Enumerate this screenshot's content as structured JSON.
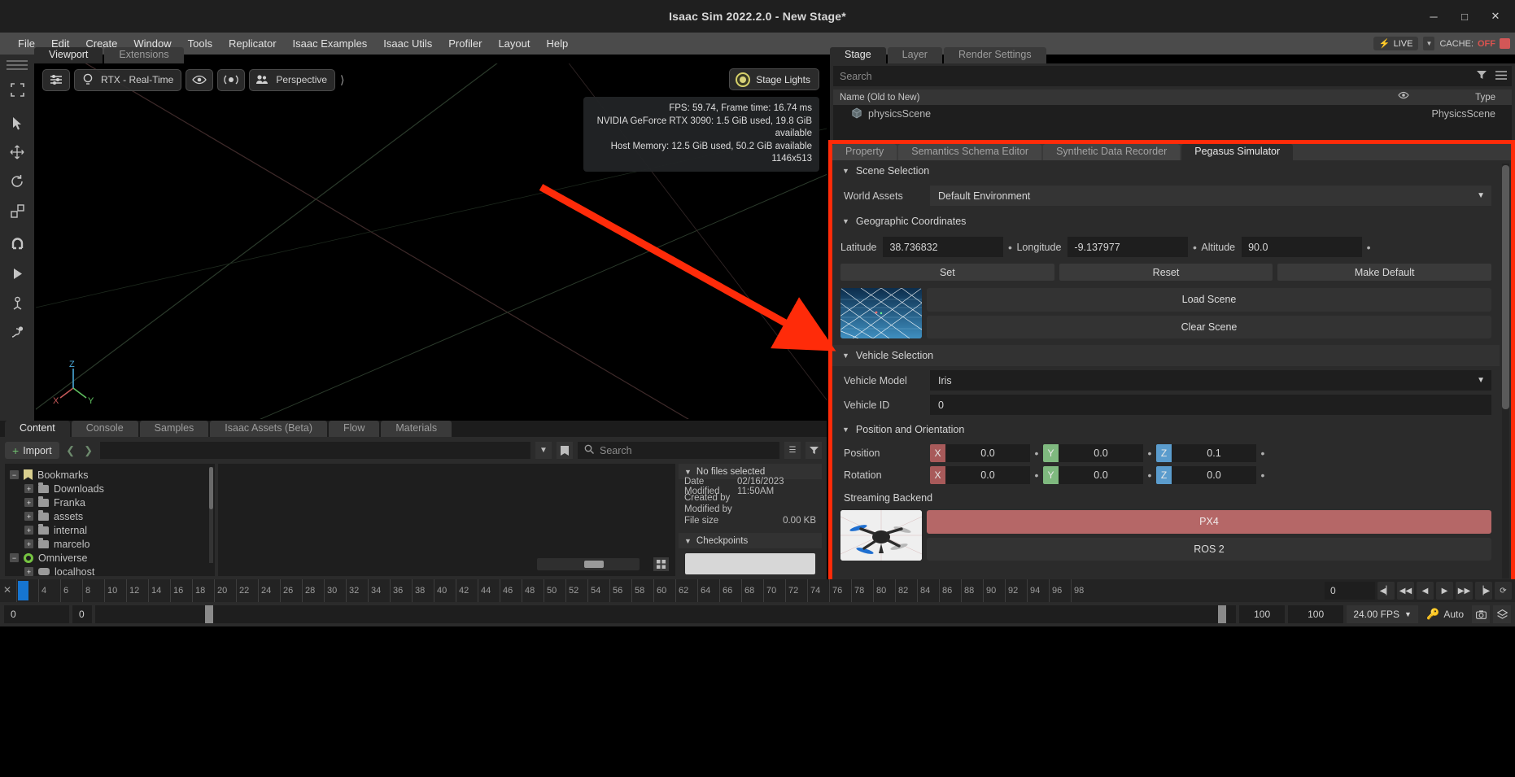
{
  "window": {
    "title": "Isaac Sim 2022.2.0 - New Stage*",
    "minimize": "─",
    "maximize": "□",
    "close": "✕"
  },
  "menubar": {
    "items": [
      "File",
      "Edit",
      "Create",
      "Window",
      "Tools",
      "Replicator",
      "Isaac Examples",
      "Isaac Utils",
      "Profiler",
      "Layout",
      "Help"
    ],
    "live_label": "LIVE",
    "cache_label": "CACHE:",
    "cache_state": "OFF"
  },
  "viewport": {
    "tabs": [
      {
        "label": "Viewport",
        "active": true
      },
      {
        "label": "Extensions",
        "active": false
      }
    ],
    "toolbar": {
      "settings_icon": "sliders-icon",
      "renderer": "RTX - Real-Time",
      "eye_icon": "eye-icon",
      "light_icon": "light-icon",
      "camera": "Perspective"
    },
    "stage_lights": "Stage Lights",
    "hud": [
      "FPS: 59.74, Frame time: 16.74 ms",
      "NVIDIA GeForce RTX 3090: 1.5 GiB used, 19.8 GiB available",
      "Host Memory: 12.5 GiB used, 50.2 GiB available",
      "1146x513"
    ],
    "axis": {
      "x": "X",
      "y": "Y",
      "z": "Z"
    }
  },
  "stage_panel": {
    "tabs": [
      {
        "label": "Stage",
        "active": true
      },
      {
        "label": "Layer",
        "active": false
      },
      {
        "label": "Render Settings",
        "active": false
      }
    ],
    "search_placeholder": "Search",
    "columns": {
      "name": "Name (Old to New)",
      "type": "Type"
    },
    "rows": [
      {
        "name": "physicsScene",
        "type": "PhysicsScene"
      }
    ]
  },
  "pegasus": {
    "tabs": [
      {
        "label": "Property",
        "active": false
      },
      {
        "label": "Semantics Schema Editor",
        "active": false
      },
      {
        "label": "Synthetic Data Recorder",
        "active": false
      },
      {
        "label": "Pegasus Simulator",
        "active": true
      }
    ],
    "scene_selection": {
      "title": "Scene Selection",
      "world_assets_label": "World Assets",
      "world_assets_value": "Default Environment",
      "geo_title": "Geographic Coordinates",
      "latitude_label": "Latitude",
      "latitude_value": "38.736832",
      "longitude_label": "Longitude",
      "longitude_value": "-9.137977",
      "altitude_label": "Altitude",
      "altitude_value": "90.0",
      "set_label": "Set",
      "reset_label": "Reset",
      "make_default_label": "Make Default",
      "load_scene_label": "Load Scene",
      "clear_scene_label": "Clear Scene"
    },
    "vehicle_selection": {
      "title": "Vehicle Selection",
      "model_label": "Vehicle Model",
      "model_value": "Iris",
      "id_label": "Vehicle ID",
      "id_value": "0",
      "pos_title": "Position and Orientation",
      "position_label": "Position",
      "position": {
        "x": "0.0",
        "y": "0.0",
        "z": "0.1"
      },
      "rotation_label": "Rotation",
      "rotation": {
        "x": "0.0",
        "y": "0.0",
        "z": "0.0"
      },
      "axis_x": "X",
      "axis_y": "Y",
      "axis_z": "Z"
    },
    "streaming": {
      "label": "Streaming Backend",
      "px4_label": "PX4",
      "ros2_label": "ROS 2"
    },
    "accent_color": "#ff2b09",
    "px4_color": "#b56767"
  },
  "content_browser": {
    "tabs": [
      {
        "label": "Content",
        "active": true
      },
      {
        "label": "Console",
        "active": false
      },
      {
        "label": "Samples",
        "active": false
      },
      {
        "label": "Isaac Assets (Beta)",
        "active": false
      },
      {
        "label": "Flow",
        "active": false
      },
      {
        "label": "Materials",
        "active": false
      }
    ],
    "import_label": "Import",
    "back_icon": "chevron-left-icon",
    "forward_icon": "chevron-right-icon",
    "path_value": "",
    "search_placeholder": "Search",
    "tree": [
      {
        "label": "Bookmarks",
        "icon": "bookmark-icon",
        "expander": "−",
        "depth": 0
      },
      {
        "label": "Downloads",
        "icon": "folder-icon",
        "expander": "+",
        "depth": 1
      },
      {
        "label": "Franka",
        "icon": "folder-icon",
        "expander": "+",
        "depth": 1
      },
      {
        "label": "assets",
        "icon": "folder-icon",
        "expander": "+",
        "depth": 1
      },
      {
        "label": "internal",
        "icon": "folder-icon",
        "expander": "+",
        "depth": 1
      },
      {
        "label": "marcelo",
        "icon": "folder-icon",
        "expander": "+",
        "depth": 1
      },
      {
        "label": "Omniverse",
        "icon": "omniverse-icon",
        "expander": "−",
        "depth": 0
      },
      {
        "label": "localhost",
        "icon": "server-icon",
        "expander": "+",
        "depth": 1
      }
    ],
    "info": {
      "title": "No files selected",
      "date_modified_label": "Date Modified",
      "date_modified_value": "02/16/2023 11:50AM",
      "created_by_label": "Created by",
      "created_by_value": "",
      "modified_by_label": "Modified by",
      "modified_by_value": "",
      "file_size_label": "File size",
      "file_size_value": "0.00 KB",
      "checkpoints_title": "Checkpoints"
    }
  },
  "timeline": {
    "ticks": [
      "2",
      "4",
      "6",
      "8",
      "10",
      "12",
      "14",
      "16",
      "18",
      "20",
      "22",
      "24",
      "26",
      "28",
      "30",
      "32",
      "34",
      "36",
      "38",
      "40",
      "42",
      "44",
      "46",
      "48",
      "50",
      "52",
      "54",
      "56",
      "58",
      "60",
      "62",
      "64",
      "66",
      "68",
      "70",
      "72",
      "74",
      "76",
      "78",
      "80",
      "82",
      "84",
      "86",
      "88",
      "90",
      "92",
      "94",
      "96",
      "98"
    ],
    "current_frame": "0",
    "controls": [
      "◀▏",
      "◀◀",
      "◀",
      "▶",
      "▶▶",
      "▕▶",
      "⟳"
    ]
  },
  "status_bar": {
    "start_value": "0",
    "range_start": "0",
    "range_end": "100",
    "end_value": "100",
    "fps_value": "24.00 FPS",
    "auto_label": "Auto",
    "key_icon": "key-icon",
    "camera_icon": "camera-icon",
    "layers_icon": "layers-icon"
  }
}
